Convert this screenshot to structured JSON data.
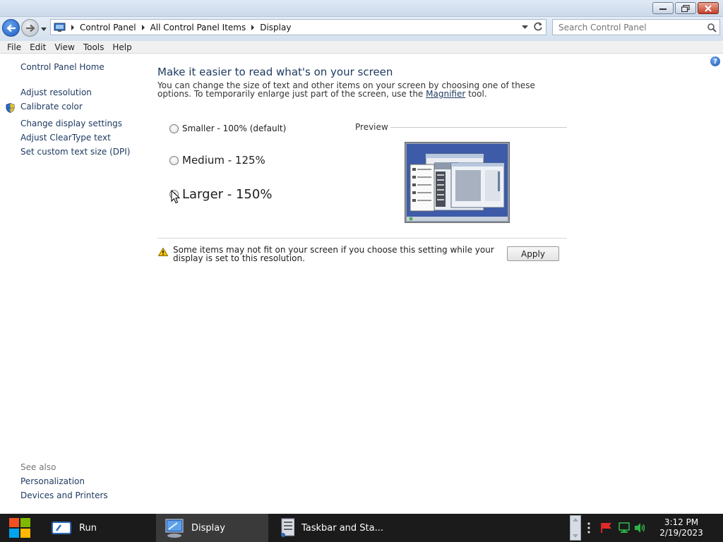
{
  "window": {
    "controls": {
      "minimize_icon": "minimize-icon",
      "maximize_icon": "restore-icon",
      "close_icon": "close-icon"
    }
  },
  "address_bar": {
    "breadcrumbs": [
      "Control Panel",
      "All Control Panel Items",
      "Display"
    ],
    "search_placeholder": "Search Control Panel"
  },
  "menu": [
    "File",
    "Edit",
    "View",
    "Tools",
    "Help"
  ],
  "sidebar": {
    "home": "Control Panel Home",
    "links": [
      "Adjust resolution",
      "Calibrate color",
      "Change display settings",
      "Adjust ClearType text",
      "Set custom text size (DPI)"
    ],
    "see_also_title": "See also",
    "see_also_links": [
      "Personalization",
      "Devices and Printers"
    ]
  },
  "main": {
    "heading": "Make it easier to read what's on your screen",
    "description_pre": "You can change the size of text and other items on your screen by choosing one of these options. To temporarily enlarge just part of the screen, use the ",
    "description_link": "Magnifier",
    "description_post": " tool.",
    "options": [
      {
        "label": "Smaller - 100% (default)",
        "checked": false
      },
      {
        "label": "Medium - 125%",
        "checked": false
      },
      {
        "label": "Larger - 150%",
        "checked": true
      }
    ],
    "preview_label": "Preview",
    "warning_text": "Some items may not fit on your screen if you choose this setting while your display is set to this resolution.",
    "apply_label": "Apply"
  },
  "taskbar": {
    "items": [
      {
        "label": "Run",
        "icon": "run-icon"
      },
      {
        "label": "Display",
        "icon": "display-icon"
      },
      {
        "label": "Taskbar and Sta...",
        "icon": "taskbar-properties-icon"
      }
    ],
    "clock_time": "3:12 PM",
    "clock_date": "2/19/2023"
  },
  "colors": {
    "link": "#1e3a60",
    "taskbar_bg": "#1b1b1b",
    "titlebar_top": "#dfe9f5"
  }
}
